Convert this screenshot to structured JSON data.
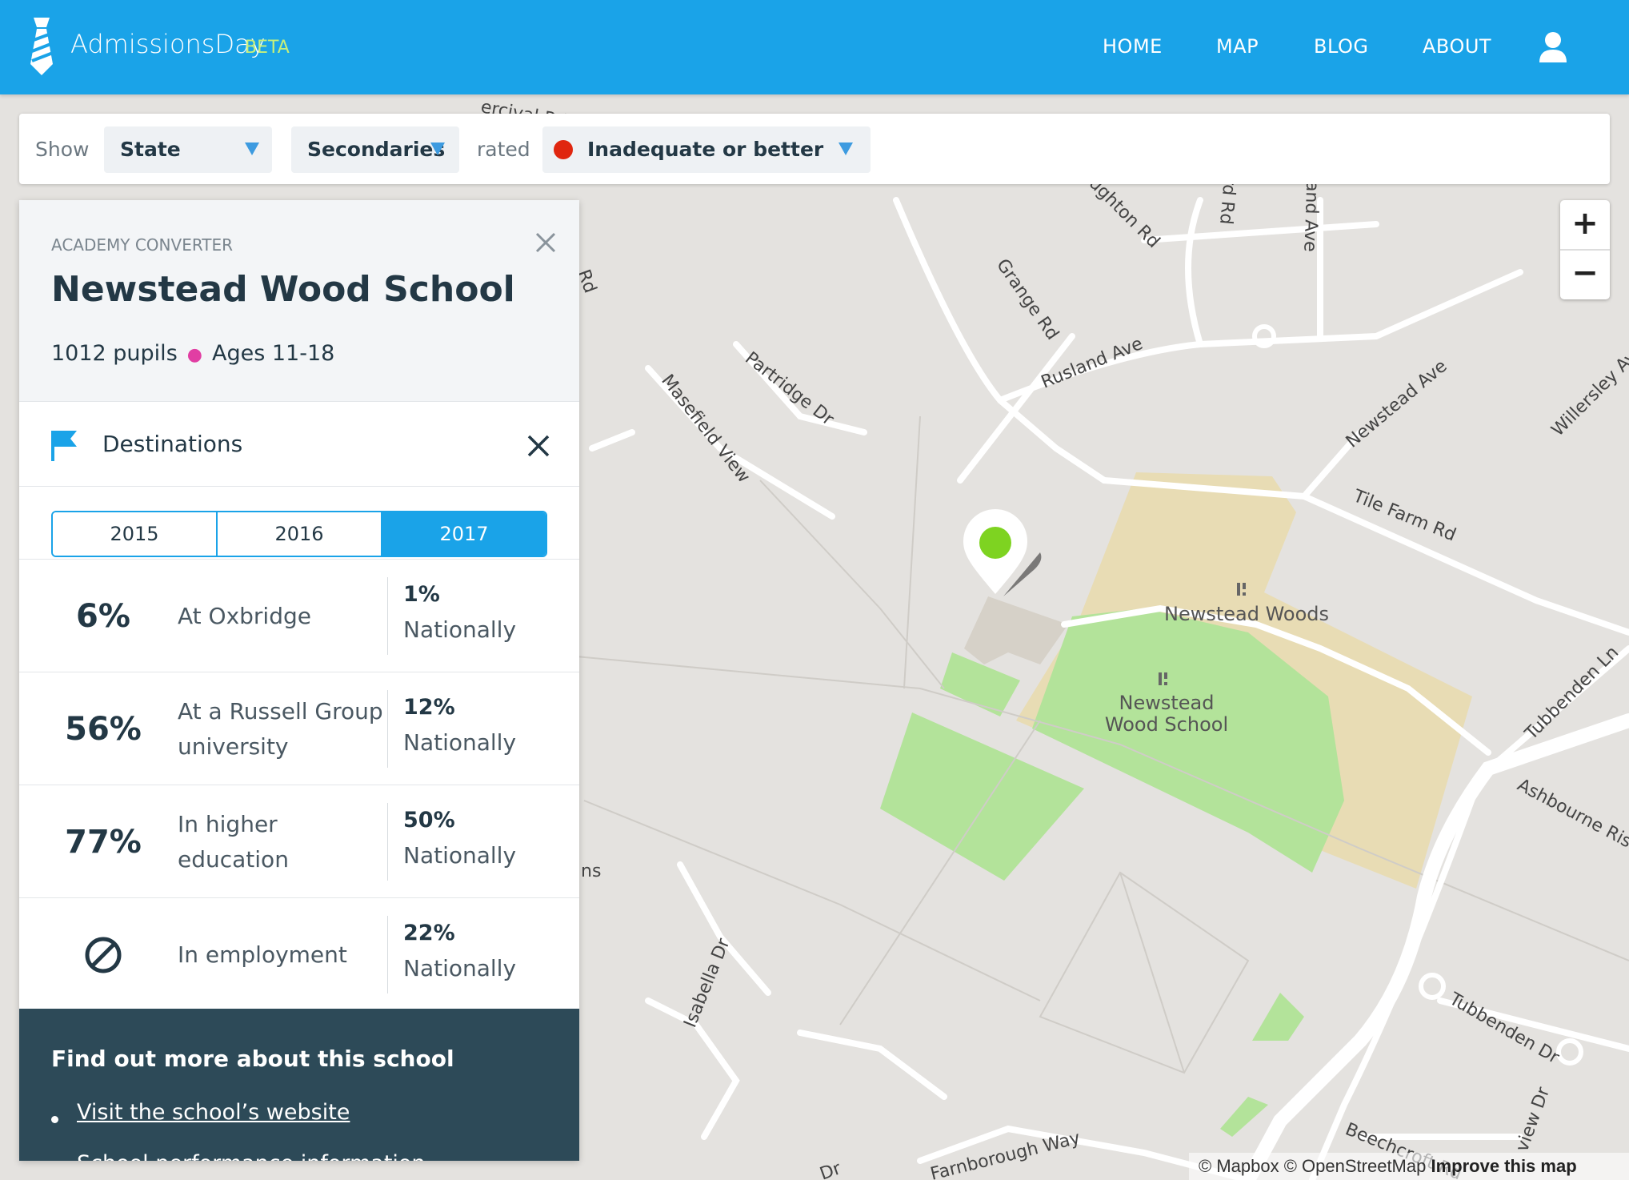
{
  "header": {
    "brand": "AdmissionsDay",
    "beta": "BETA",
    "nav": [
      "HOME",
      "MAP",
      "BLOG",
      "ABOUT"
    ]
  },
  "filter": {
    "show_label": "Show",
    "state": "State",
    "school_type": "Secondaries",
    "rated_label": "rated",
    "rating": "Inadequate or better",
    "rating_color": "#e0260f"
  },
  "zoom": {
    "in": "+",
    "out": "−"
  },
  "school": {
    "type": "ACADEMY CONVERTER",
    "name": "Newstead Wood School",
    "pupils": "1012 pupils",
    "ages": "Ages 11-18"
  },
  "destinations": {
    "title": "Destinations",
    "years": [
      "2015",
      "2016",
      "2017"
    ],
    "active_year": "2017",
    "rows": [
      {
        "value": "6%",
        "label": "At Oxbridge",
        "national_pct": "1%",
        "national_label": "Nationally"
      },
      {
        "value": "56%",
        "label": "At a Russell Group university",
        "national_pct": "12%",
        "national_label": "Nationally"
      },
      {
        "value": "77%",
        "label": "In higher education",
        "national_pct": "50%",
        "national_label": "Nationally"
      },
      {
        "value": "",
        "label": "In employment",
        "national_pct": "22%",
        "national_label": "Nationally"
      }
    ]
  },
  "more": {
    "title": "Find out more about this school",
    "links": [
      "Visit the school’s website",
      "School performance information"
    ]
  },
  "map": {
    "streets": [
      "ercival Rd",
      "Rd",
      "Partridge Dr",
      "Masefield View",
      "Grange Rd",
      "Rusland Ave",
      "ughton Rd",
      "ford Rd",
      "Rusland Ave",
      "Newstead Ave",
      "Willersley Ave",
      "Tile Farm Rd",
      "Tubbenden Ln",
      "Ashbourne Rise",
      "Tubbenden Dr",
      "Isabella Dr",
      "Farnborough Way",
      "Beechcroft Rd",
      "Dr",
      "ns",
      "view Dr"
    ],
    "pois": [
      "Newstead Woods",
      "Newstead",
      "Wood School"
    ],
    "attribution_mapbox": "© Mapbox",
    "attribution_osm": "© OpenStreetMap",
    "attribution_improve": "Improve this map"
  }
}
